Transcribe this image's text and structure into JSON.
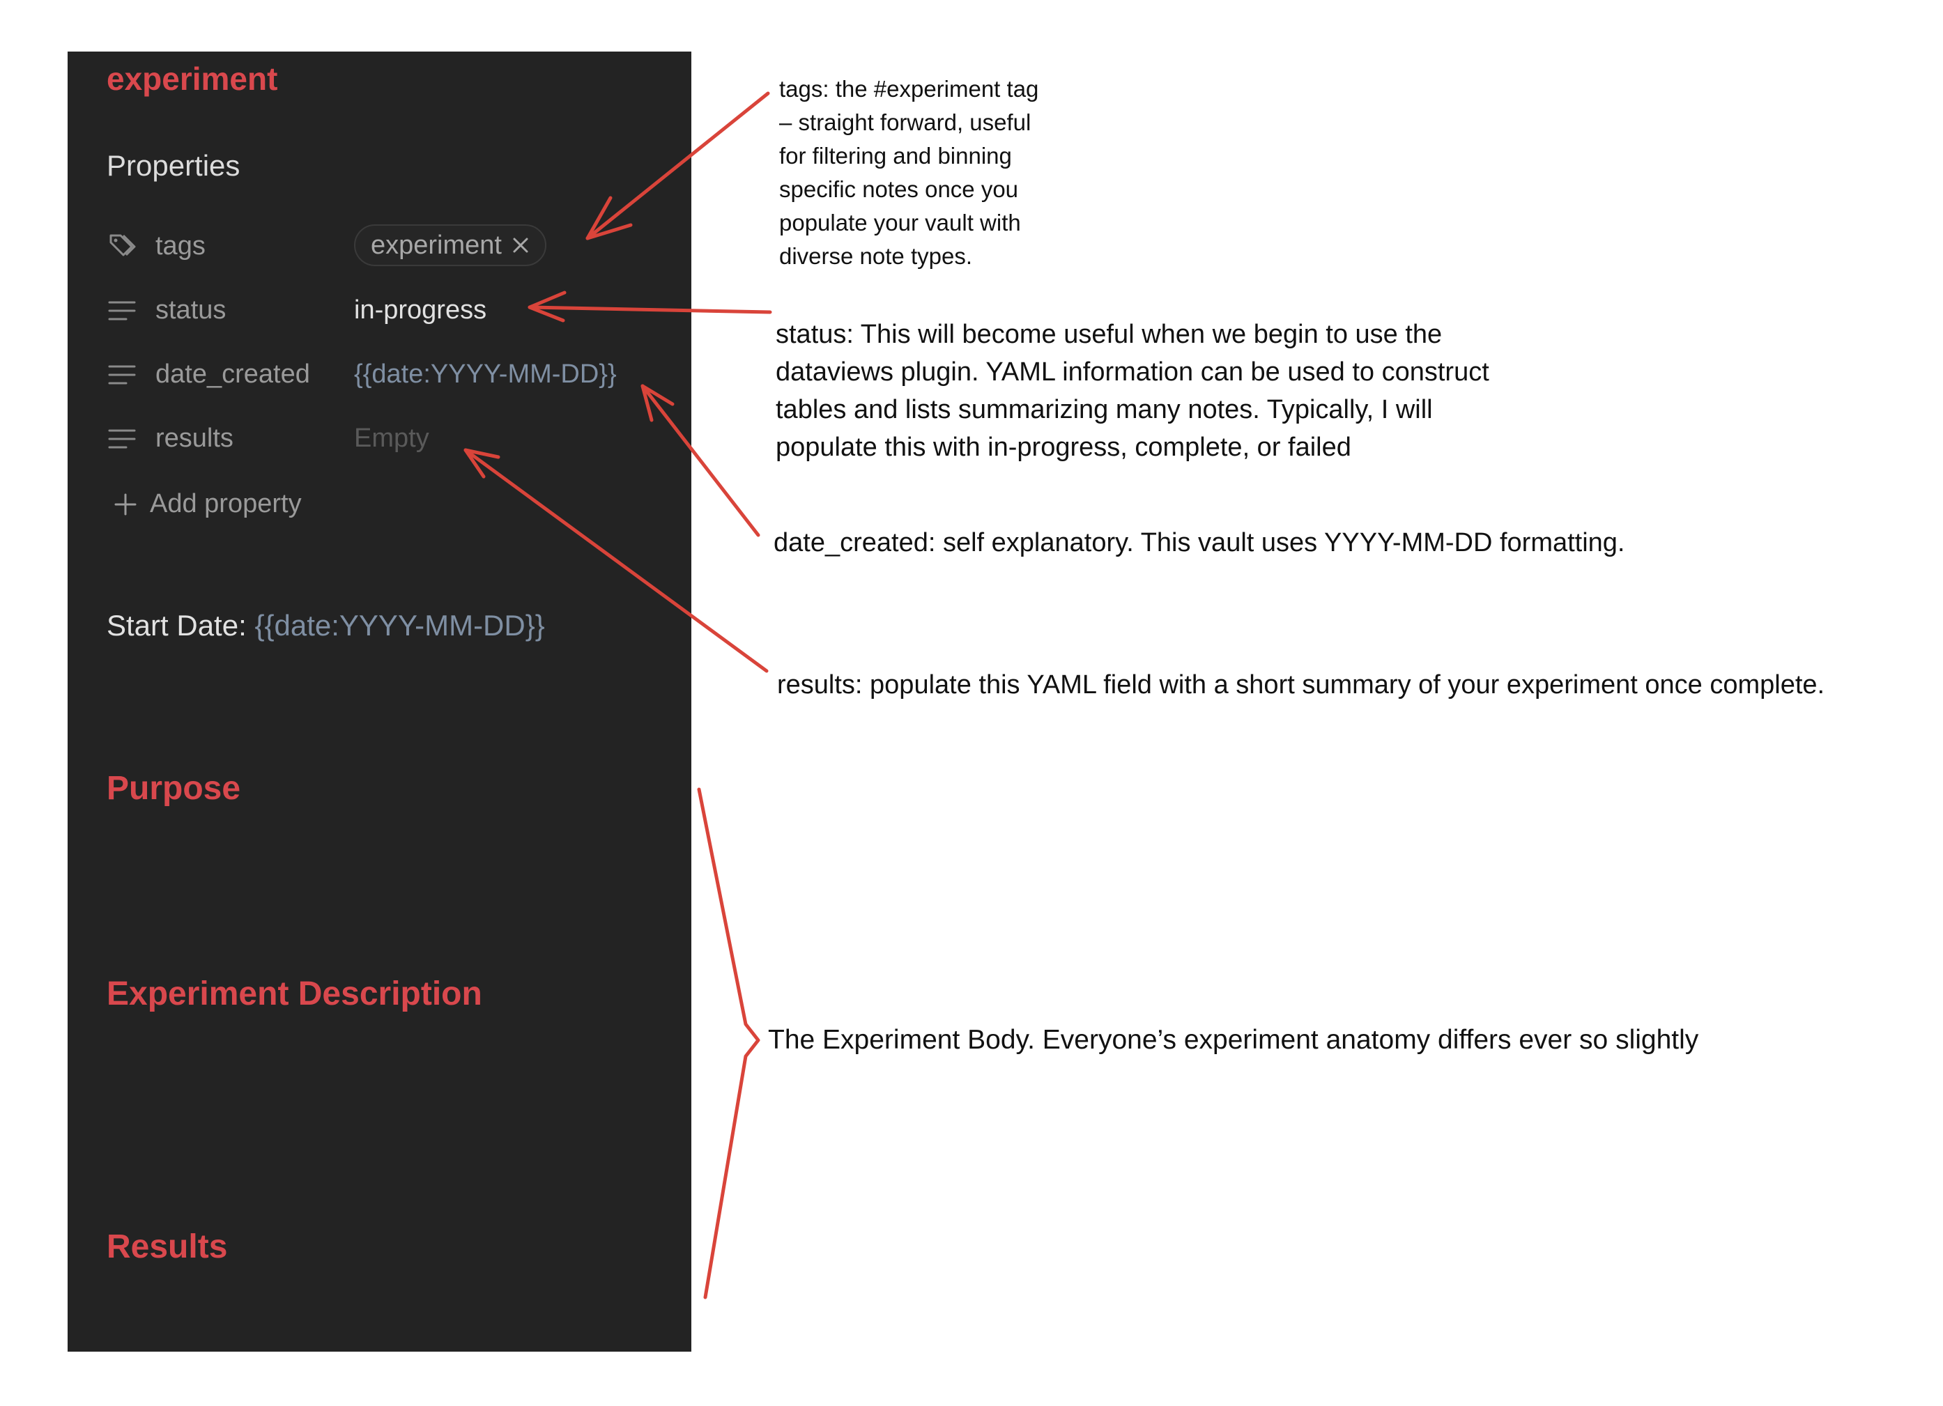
{
  "note": {
    "title": "experiment",
    "properties_heading": "Properties",
    "properties": [
      {
        "key": "tags",
        "icon": "tags-icon",
        "value": "experiment"
      },
      {
        "key": "status",
        "icon": "text-lines-icon",
        "value": "in-progress"
      },
      {
        "key": "date_created",
        "icon": "text-lines-icon",
        "value": "{{date:YYYY-MM-DD}}"
      },
      {
        "key": "results",
        "icon": "text-lines-icon",
        "value": "Empty"
      }
    ],
    "add_property_label": "Add property",
    "start_date_label": "Start Date:",
    "start_date_value": "{{date:YYYY-MM-DD}}",
    "sections": [
      "Purpose",
      "Experiment Description",
      "Results"
    ]
  },
  "annotations": {
    "tags": [
      "tags: the #experiment tag",
      "– straight forward, useful",
      "for filtering and binning",
      "specific notes once you",
      "populate your vault with",
      "diverse note types."
    ],
    "status": [
      "status: This will become useful when we begin to use the",
      "dataviews plugin. YAML information can be used to construct",
      "tables and lists summarizing many notes. Typically, I will",
      "populate this with in-progress, complete, or failed"
    ],
    "date_created": "date_created: self explanatory. This vault uses YYYY-MM-DD formatting.",
    "results": "results: populate this YAML field with a short summary of your experiment once complete.",
    "body": "The Experiment Body. Everyone’s experiment anatomy differs ever so slightly"
  },
  "colors": {
    "accent_red": "#d9484d",
    "panel_bg": "#232323",
    "template_value": "#7f8fa3",
    "annotation_arrow": "#d9443a"
  }
}
